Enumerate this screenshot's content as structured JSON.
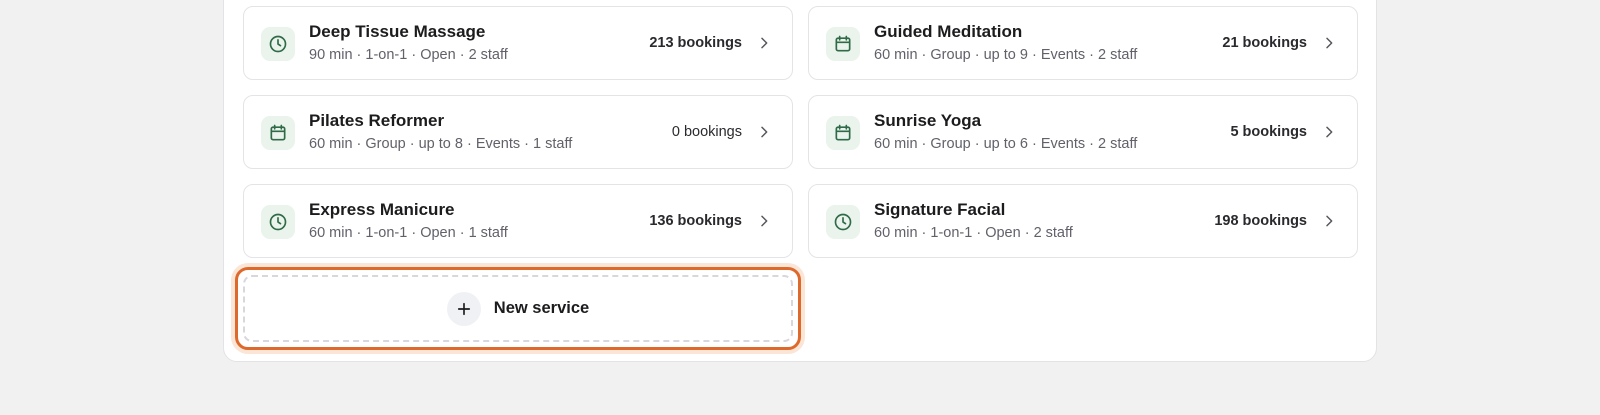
{
  "colors": {
    "accent": "#2f6b47",
    "focus_ring": "#dd6a2c",
    "icon_bg": "#eaf3ec"
  },
  "services": [
    {
      "name": "Deep Tissue Massage",
      "meta": "90 min · 1-on-1 · Open · 2 staff",
      "bookings": "213 bookings",
      "icon": "clock-icon"
    },
    {
      "name": "Guided Meditation",
      "meta": "60 min · Group · up to 9 · Events · 2 staff",
      "bookings": "21 bookings",
      "icon": "calendar-icon"
    },
    {
      "name": "Pilates Reformer",
      "meta": "60 min · Group · up to 8 · Events · 1 staff",
      "bookings": "0 bookings",
      "icon": "calendar-icon"
    },
    {
      "name": "Sunrise Yoga",
      "meta": "60 min · Group · up to 6 · Events · 2 staff",
      "bookings": "5 bookings",
      "icon": "calendar-icon"
    },
    {
      "name": "Express Manicure",
      "meta": "60 min · 1-on-1 · Open · 1 staff",
      "bookings": "136 bookings",
      "icon": "clock-icon"
    },
    {
      "name": "Signature Facial",
      "meta": "60 min · 1-on-1 · Open · 2 staff",
      "bookings": "198 bookings",
      "icon": "clock-icon"
    }
  ],
  "new_service": {
    "label": "New service",
    "icon": "plus-icon"
  }
}
